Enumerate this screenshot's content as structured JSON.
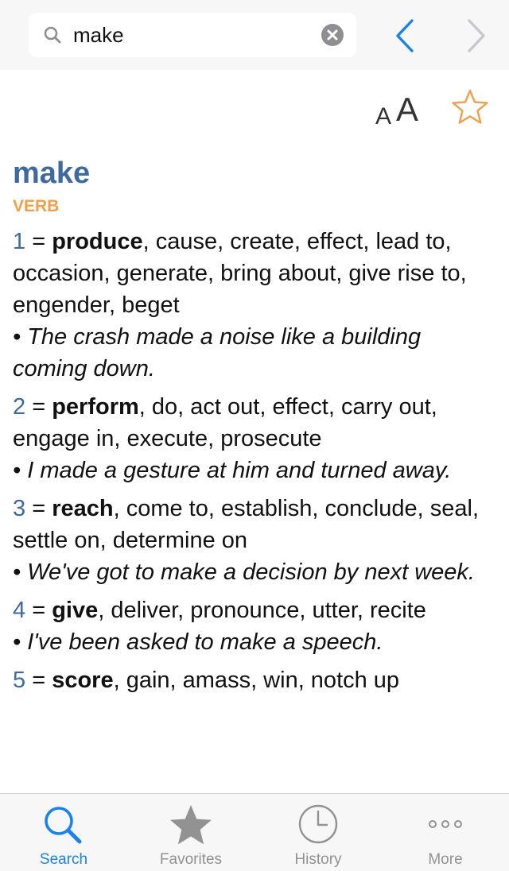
{
  "search": {
    "value": "make",
    "placeholder": ""
  },
  "colors": {
    "accent": "#1a82e8",
    "headword": "#3e6a9e",
    "pos": "#f0a04b",
    "inactive": "#929292"
  },
  "toolbar": {
    "font_small": "A",
    "font_large": "A"
  },
  "entry": {
    "headword": "make",
    "pos": "VERB",
    "senses": [
      {
        "num": "1",
        "eq": " = ",
        "main": "produce",
        "rest": ", cause, create, effect, lead to, occasion, generate, bring about, give rise to, engender, beget",
        "example": "• The crash made a noise like a building coming down."
      },
      {
        "num": "2",
        "eq": " = ",
        "main": "perform",
        "rest": ", do, act out, effect, carry out, engage in, execute, prosecute",
        "example": "• I made a gesture at him and turned away."
      },
      {
        "num": "3",
        "eq": " = ",
        "main": "reach",
        "rest": ", come to, establish, conclude, seal, settle on, determine on",
        "example": "• We've got to make a decision by next week."
      },
      {
        "num": "4",
        "eq": " = ",
        "main": "give",
        "rest": ", deliver, pronounce, utter, recite",
        "example": "• I've been asked to make a speech."
      },
      {
        "num": "5",
        "eq": " = ",
        "main": "score",
        "rest": ", gain, amass, win, notch up",
        "example": ""
      }
    ]
  },
  "tabs": [
    {
      "label": "Search",
      "icon": "search-icon"
    },
    {
      "label": "Favorites",
      "icon": "star-icon"
    },
    {
      "label": "History",
      "icon": "clock-icon"
    },
    {
      "label": "More",
      "icon": "more-icon"
    }
  ]
}
